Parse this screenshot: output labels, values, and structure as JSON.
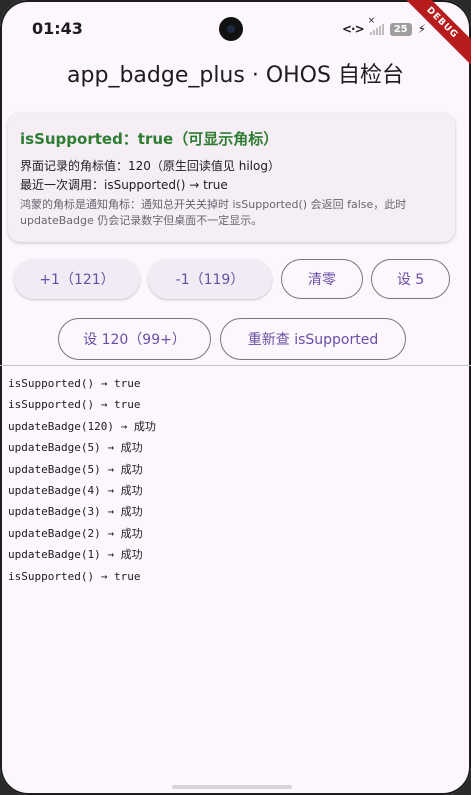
{
  "status": {
    "time": "01:43",
    "battery": "25"
  },
  "debug_banner": "DEBUG",
  "app_title": "app_badge_plus · OHOS 自检台",
  "info_card": {
    "title": "isSupported：true（可显示角标）",
    "line1": "界面记录的角标值：120（原生回读值见 hilog）",
    "line2": "最近一次调用：isSupported() → true",
    "note": "鸿蒙的角标是通知角标：通知总开关关掉时 isSupported() 会返回 false，此时 updateBadge 仍会记录数字但桌面不一定显示。"
  },
  "buttons": {
    "plus_one": "+1（121）",
    "minus_one": "-1（119）",
    "clear": "清零",
    "set_5": "设 5",
    "set_120": "设 120（99+）",
    "recheck": "重新查 isSupported"
  },
  "log": [
    "isSupported() → true",
    "isSupported() → true",
    "updateBadge(120) → 成功",
    "updateBadge(5) → 成功",
    "updateBadge(5) → 成功",
    "updateBadge(4) → 成功",
    "updateBadge(3) → 成功",
    "updateBadge(2) → 成功",
    "updateBadge(1) → 成功",
    "isSupported() → true"
  ],
  "colors": {
    "accent": "#6750a4",
    "supported_green": "#2e7d32",
    "background": "#fdf7fd"
  }
}
